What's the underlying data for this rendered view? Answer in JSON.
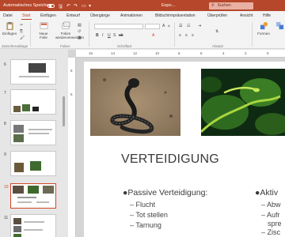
{
  "titlebar": {
    "autosave_label": "Automatisches Speichern",
    "doc_name": "Expo...",
    "search_label": "Suchen"
  },
  "tabs": [
    "Datei",
    "Start",
    "Einfügen",
    "Entwurf",
    "Übergänge",
    "Animationen",
    "Bildschirmpräsentation",
    "Überprüfen",
    "Ansicht",
    "Hilfe"
  ],
  "tabs_active": "Start",
  "ribbon": {
    "paste_label": "Einfügen",
    "new_slide_label": "Neue Folie",
    "reuse_label": "Folien wiederverwenden",
    "shape_label": "Formen",
    "groups": {
      "clipboard": "Zwischenablage",
      "slides": "Folien",
      "font": "Schriftart",
      "paragraph": "Absatz"
    }
  },
  "thumbnails": [
    {
      "num": "6"
    },
    {
      "num": "7"
    },
    {
      "num": "8"
    },
    {
      "num": "9"
    },
    {
      "num": "10",
      "selected": true
    },
    {
      "num": "11"
    }
  ],
  "ruler": {
    "top": [
      "16",
      "14",
      "12",
      "10",
      "8",
      "6",
      "4",
      "2",
      "0",
      "2"
    ],
    "left": [
      "8",
      "6"
    ]
  },
  "slide": {
    "title": "VERTEIDIGUNG",
    "col1": {
      "heading": "Passive Verteidigung:",
      "items": [
        "Flucht",
        "Tot stellen",
        "Tarnung"
      ]
    },
    "col2": {
      "heading": "Aktiv",
      "items": [
        "Abw",
        "Aufr",
        "spre",
        "Zisc"
      ]
    }
  },
  "colors": {
    "accent": "#b7472a",
    "selected_thumb_border": "#d24726"
  }
}
